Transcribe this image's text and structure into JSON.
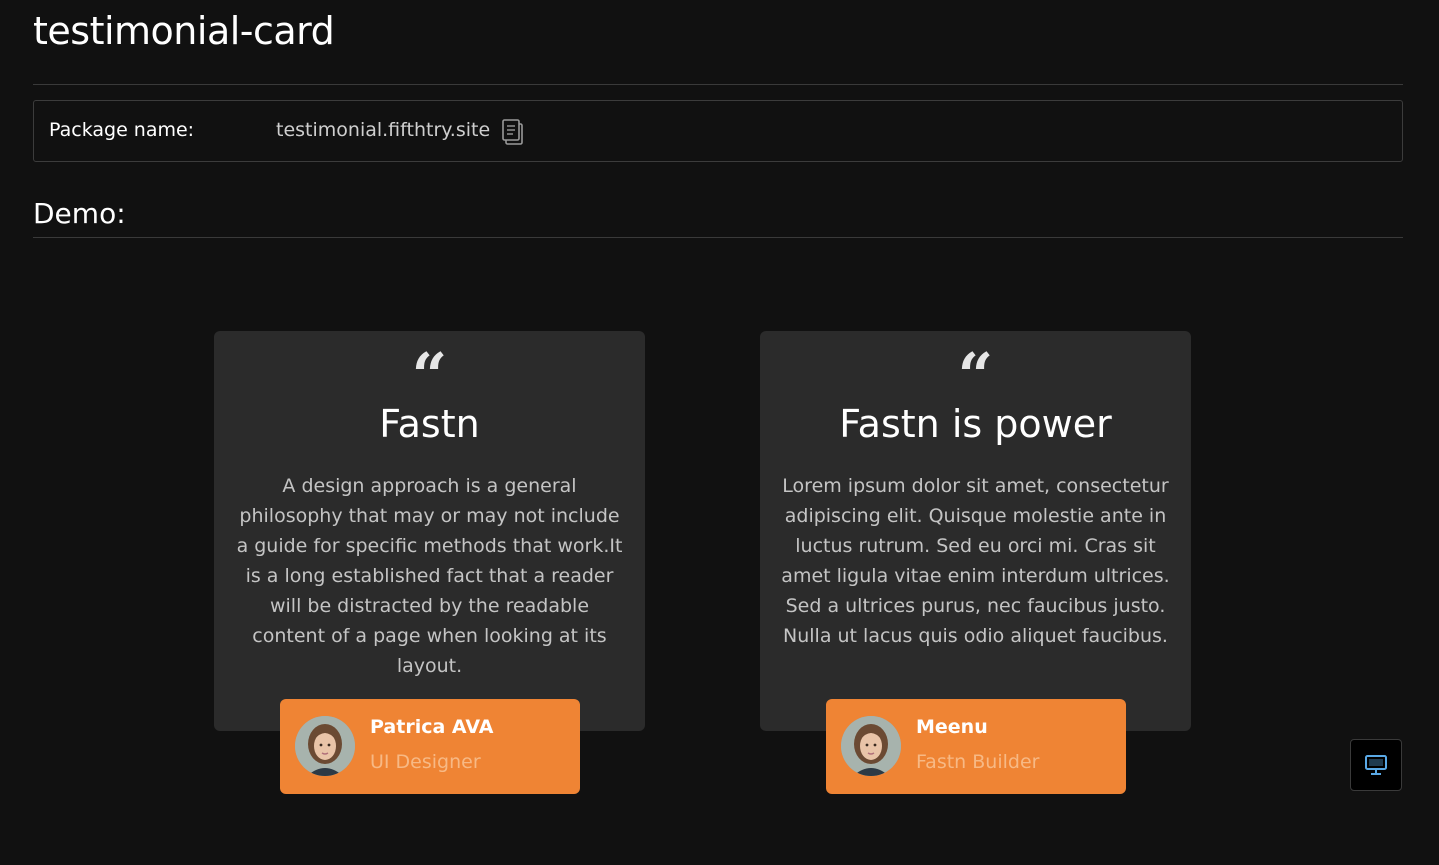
{
  "page": {
    "title": "testimonial-card"
  },
  "package": {
    "label": "Package name:",
    "value": "testimonial.fifthtry.site",
    "copy_icon": "copy-icon"
  },
  "demo": {
    "heading": "Demo:"
  },
  "cards": [
    {
      "quote_icon": "quote-icon",
      "quote_glyph": "“",
      "title": "Fastn",
      "text": "A design approach is a general philosophy that may or may not include a guide for specific methods that work.It is a long established fact that a reader will be distracted by the readable content of a page when looking at its layout.",
      "author": {
        "name": "Patrica AVA",
        "role": "UI Designer",
        "avatar": "avatar-photo"
      }
    },
    {
      "quote_icon": "quote-icon",
      "quote_glyph": "“",
      "title": "Fastn is power",
      "text": "Lorem ipsum dolor sit amet, consectetur adipiscing elit. Quisque molestie ante in luctus rutrum. Sed eu orci mi. Cras sit amet ligula vitae enim interdum ultrices. Sed a ultrices purus, nec faucibus justo. Nulla ut lacus quis odio aliquet faucibus.",
      "author": {
        "name": "Meenu",
        "role": "Fastn Builder",
        "avatar": "avatar-photo"
      }
    }
  ],
  "device_toggle": {
    "icon": "desktop-icon"
  },
  "colors": {
    "background": "#111111",
    "card": "#2b2b2b",
    "accent": "#ef8434",
    "role_text": "#f7b985",
    "device_icon": "#5aa9e6"
  }
}
